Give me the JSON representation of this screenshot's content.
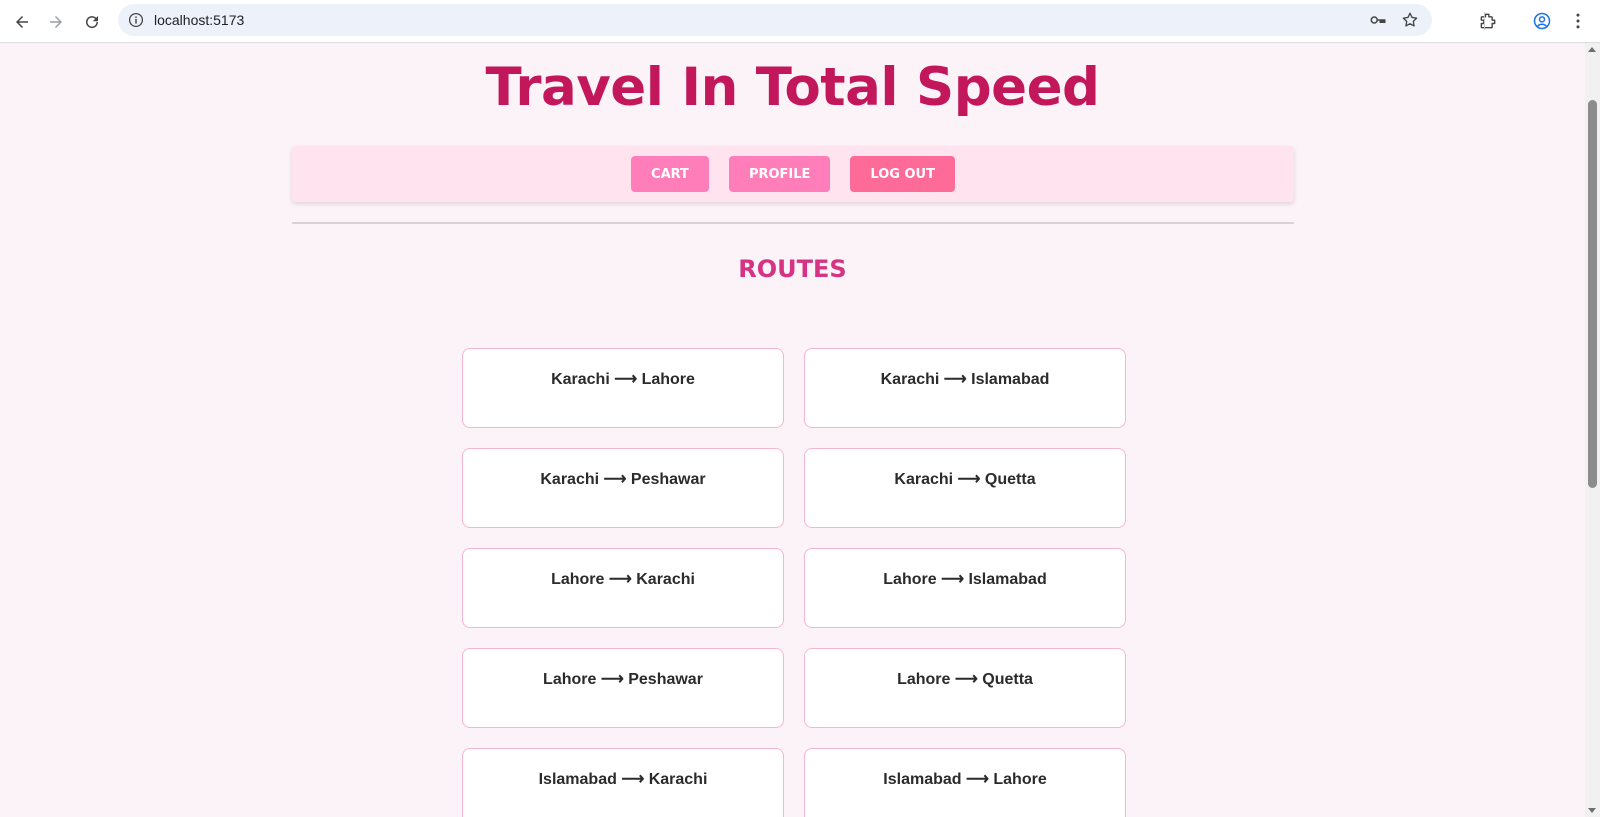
{
  "browser": {
    "url": "localhost:5173"
  },
  "header": {
    "title": "Travel In Total Speed"
  },
  "navbar": {
    "cart_label": "CART",
    "profile_label": "PROFILE",
    "logout_label": "LOG OUT"
  },
  "routes": {
    "heading": "ROUTES",
    "items": [
      {
        "label": "Karachi ⟶ Lahore"
      },
      {
        "label": "Karachi ⟶ Islamabad"
      },
      {
        "label": "Karachi ⟶ Peshawar"
      },
      {
        "label": "Karachi ⟶ Quetta"
      },
      {
        "label": "Lahore ⟶ Karachi"
      },
      {
        "label": "Lahore ⟶ Islamabad"
      },
      {
        "label": "Lahore ⟶ Peshawar"
      },
      {
        "label": "Lahore ⟶ Quetta"
      },
      {
        "label": "Islamabad ⟶ Karachi"
      },
      {
        "label": "Islamabad ⟶ Lahore"
      }
    ]
  },
  "colors": {
    "title": "#c2185b",
    "nav_button": "#ff7eb9",
    "logout_button": "#ff6b98",
    "routes_heading": "#d63384",
    "page_background": "#fbf3f7"
  }
}
